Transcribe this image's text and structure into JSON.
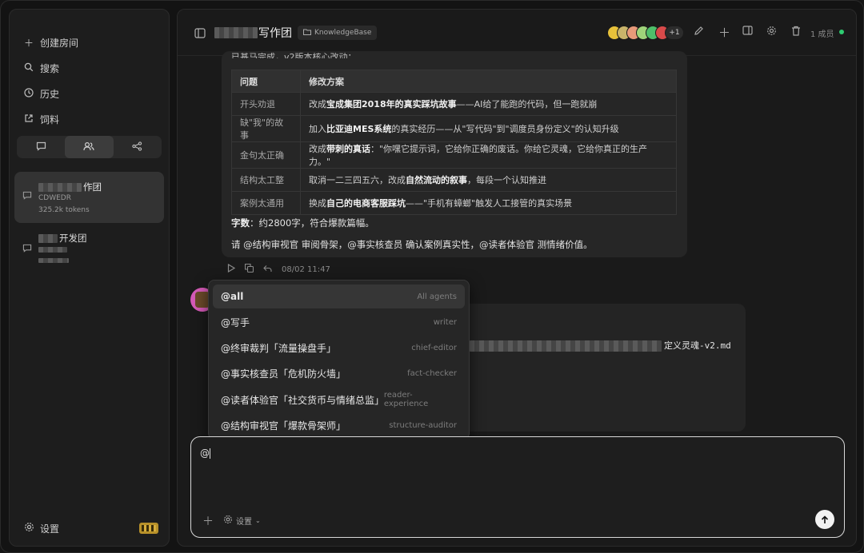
{
  "window": {
    "traffic_colors": [
      "#fe5f57",
      "#febc2e",
      "#28c840"
    ]
  },
  "sidebar": {
    "nav": [
      {
        "icon": "plus-icon",
        "label": "创建房间"
      },
      {
        "icon": "search-icon",
        "label": "搜索"
      },
      {
        "icon": "clock-icon",
        "label": "历史"
      },
      {
        "icon": "external-link-icon",
        "label": "饲料"
      }
    ],
    "segments": [
      "chat-icon",
      "users-icon",
      "share-icon"
    ],
    "rooms": [
      {
        "name": "作团",
        "sub": "CDWEDR",
        "tokens": "325.2k tokens"
      },
      {
        "name": "开发团"
      }
    ],
    "settings_label": "设置"
  },
  "header": {
    "title": "写作团",
    "tag": "KnowledgeBase",
    "more_count": "+1",
    "members": "1 成员"
  },
  "message": {
    "partial_top": "已基马完成，v2版本核心改动：",
    "columns": [
      "问题",
      "修改方案"
    ],
    "rows": [
      {
        "problem": "开头劝退",
        "pre": "改成",
        "bold": "宝成集团2018年的真实踩坑故事",
        "post": "——AI给了能跑的代码，但一跑就崩"
      },
      {
        "problem": "缺\"我\"的故事",
        "pre": "加入",
        "bold": "比亚迪MES系统",
        "post": "的真实经历——从\"写代码\"到\"调度员身份定义\"的认知升级"
      },
      {
        "problem": "金句太正确",
        "pre": "改成",
        "bold": "带刺的真话",
        "post": "：\"你嘿它提示词，它给你正确的废话。你给它灵魂，它给你真正的生产力。\""
      },
      {
        "problem": "结构太工整",
        "pre": "取消一二三四五六，改成",
        "bold": "自然流动的叙事",
        "post": "，每段一个认知推进"
      },
      {
        "problem": "案例太通用",
        "pre": "换成",
        "bold": "自己的电商客服踩坑",
        "post": "——\"手机有蟑螂\"触发人工接管的真实场景"
      }
    ],
    "word_label": "字数",
    "word_text": "：约2800字，符合爆款篇幅。",
    "request": "请 @结构审视官 审阅骨架，@事实核查员 确认案例真实性，@读者体验官 测情绪价值。",
    "time": "08/02 11:47"
  },
  "second_message": {
    "file_suffix": "定义灵魂-v2.md"
  },
  "mention_menu": [
    {
      "label": "@all",
      "key": "All agents"
    },
    {
      "label": "@写手",
      "key": "writer"
    },
    {
      "label": "@终审裁判「流量操盘手」",
      "key": "chief-editor"
    },
    {
      "label": "@事实核查员「危机防火墙」",
      "key": "fact-checker"
    },
    {
      "label": "@读者体验官「社交货币与情绪总监」",
      "key": "reader-experience"
    },
    {
      "label": "@结构审视官「爆款骨架师」",
      "key": "structure-auditor"
    }
  ],
  "composer": {
    "value": "@",
    "settings_label": "设置"
  }
}
